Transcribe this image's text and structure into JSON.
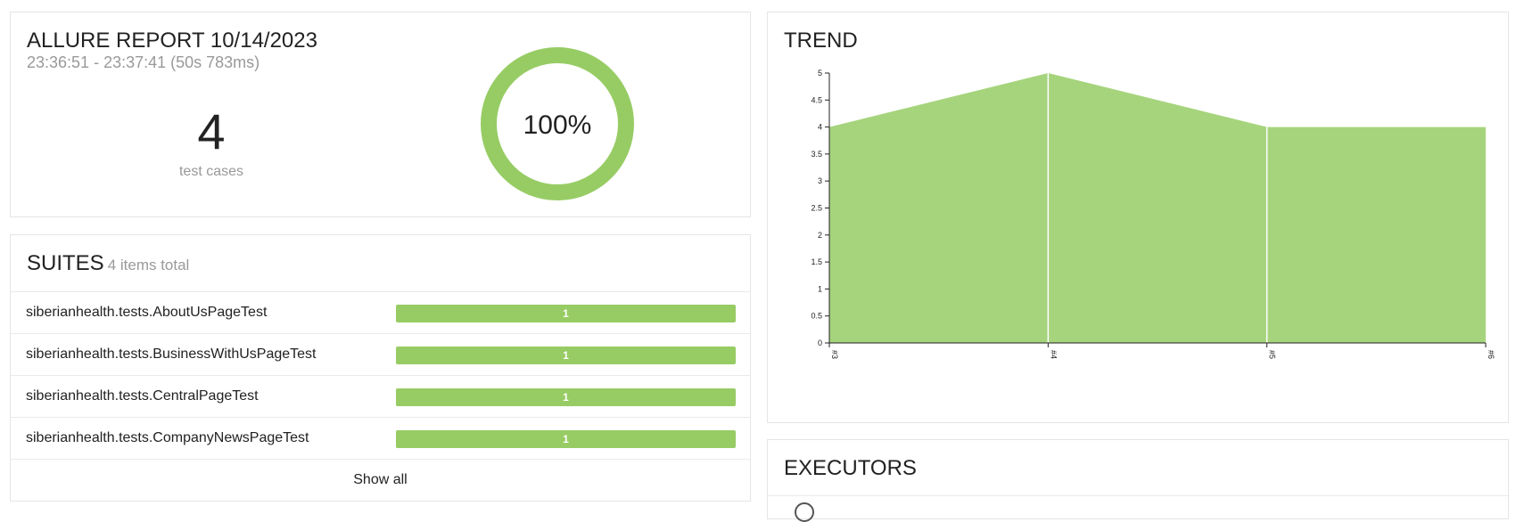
{
  "summary": {
    "title": "ALLURE REPORT 10/14/2023",
    "duration": "23:36:51 - 23:37:41 (50s 783ms)",
    "test_count": "4",
    "test_count_label": "test cases",
    "pass_rate_label": "100%",
    "pass_rate": 1.0,
    "colors": {
      "passed": "#97cc64"
    }
  },
  "suites": {
    "title": "SUITES",
    "subtitle": "4 items total",
    "items": [
      {
        "name": "siberianhealth.tests.AboutUsPageTest",
        "count": "1"
      },
      {
        "name": "siberianhealth.tests.BusinessWithUsPageTest",
        "count": "1"
      },
      {
        "name": "siberianhealth.tests.CentralPageTest",
        "count": "1"
      },
      {
        "name": "siberianhealth.tests.CompanyNewsPageTest",
        "count": "1"
      }
    ],
    "show_all_label": "Show all"
  },
  "trend": {
    "title": "TREND"
  },
  "chart_data": {
    "type": "area",
    "title": "",
    "categories": [
      "#3",
      "#4",
      "#5",
      "#6"
    ],
    "series": [
      {
        "values": [
          4,
          5,
          4,
          4
        ],
        "color": "#a6d47d"
      }
    ],
    "ylim": [
      0,
      5
    ],
    "yticks": [
      "0",
      "0.5",
      "1",
      "1.5",
      "2",
      "2.5",
      "3",
      "3.5",
      "4",
      "4.5",
      "5"
    ],
    "grid": false,
    "xlabel": "",
    "ylabel": ""
  },
  "executors": {
    "title": "EXECUTORS",
    "icon": "executor-icon"
  }
}
